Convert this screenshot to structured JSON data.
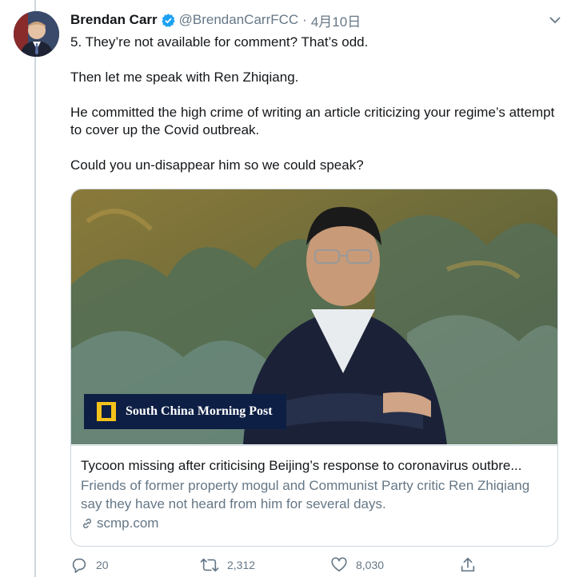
{
  "tweet": {
    "author_name": "Brendan Carr",
    "handle": "@BrendanCarrFCC",
    "separator": "·",
    "date": "4月10日",
    "paragraphs": [
      "5. They’re not available for comment?  That’s odd.",
      "Then let me speak with Ren Zhiqiang.",
      "He committed the high crime of writing an article criticizing your regime’s attempt to cover up the Covid outbreak.",
      "Could you un-disappear him so we could speak?"
    ]
  },
  "card": {
    "brand_name": "South China Morning Post",
    "title": "Tycoon missing after criticising Beijing’s response to coronavirus outbre...",
    "description": "Friends of former property mogul and Communist Party critic Ren Zhiqiang say they have not heard from him for several days.",
    "domain": "scmp.com"
  },
  "actions": {
    "replies": "20",
    "retweets": "2,312",
    "likes": "8,030"
  },
  "colors": {
    "accent": "#1da1f2",
    "muted": "#657786",
    "border": "#ccd6dd",
    "scmp_navy": "#0d1f44",
    "scmp_yellow": "#f4c21a"
  },
  "icons": [
    "verified-badge-icon",
    "chevron-down-icon",
    "link-icon",
    "reply-icon",
    "retweet-icon",
    "like-icon",
    "share-icon"
  ]
}
